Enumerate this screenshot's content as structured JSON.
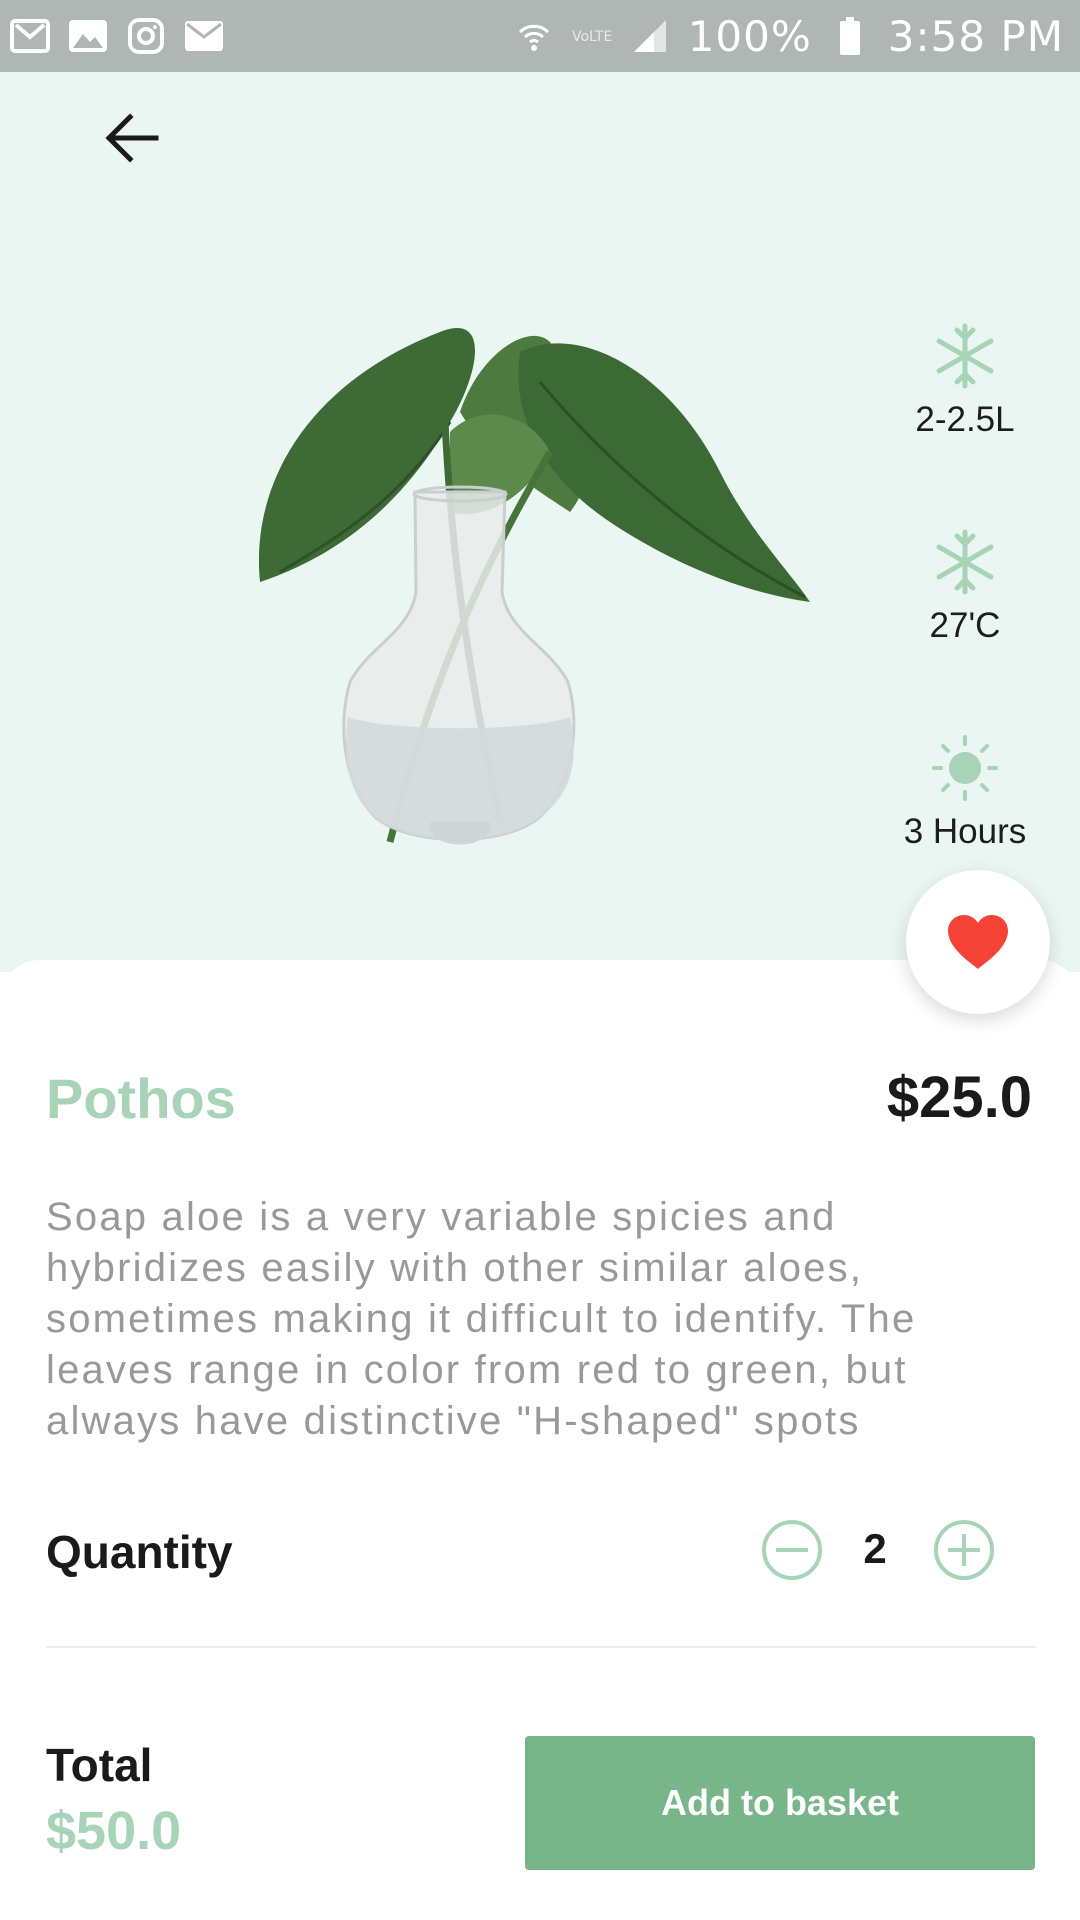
{
  "status_bar": {
    "battery": "100%",
    "time": "3:58 PM",
    "icons": [
      "gmail-icon",
      "gallery-icon",
      "instagram-icon",
      "email-icon",
      "wifi-icon",
      "volte-icon",
      "signal-icon",
      "battery-icon"
    ]
  },
  "header": {
    "back_icon": "arrow-left-icon"
  },
  "care": {
    "water": {
      "icon": "snowflake-icon",
      "label": "2-2.5L"
    },
    "temperature": {
      "icon": "snowflake-icon",
      "label": "27'C"
    },
    "light": {
      "icon": "sun-icon",
      "label": "3 Hours"
    }
  },
  "favorite": {
    "icon": "heart-icon",
    "color": "#f44336"
  },
  "product": {
    "name": "Pothos",
    "price": "$25.0",
    "description": "Soap aloe is a very variable spicies and hybridizes easily with other similar aloes, sometimes making it difficult to identify. The leaves range in color from red to green, but always have distinctive \"H-shaped\" spots"
  },
  "quantity": {
    "label": "Quantity",
    "value": "2"
  },
  "total": {
    "label": "Total",
    "value": "$50.0"
  },
  "actions": {
    "add_to_basket": "Add to basket"
  },
  "colors": {
    "accent": "#a7d3b6",
    "button": "#78b68a",
    "hero_bg": "#eaf6f2",
    "status_bar": "#b0b6b3"
  }
}
